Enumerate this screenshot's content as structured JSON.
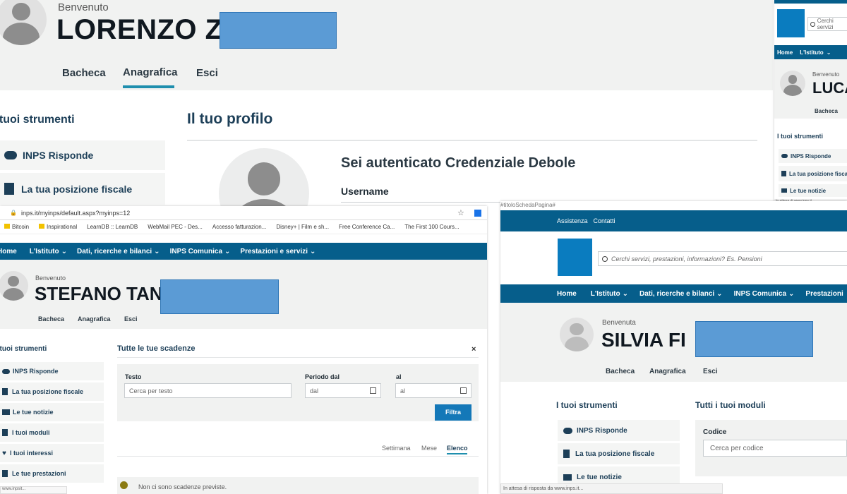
{
  "p1": {
    "welcome": "Benvenuto",
    "name": "LORENZO Z",
    "nav": [
      "Bacheca",
      "Anagrafica",
      "Esci"
    ],
    "tools_title": "I tuoi strumenti",
    "tools": [
      "INPS Risponde",
      "La tua posizione fiscale"
    ],
    "profile_title": "Il tuo profilo",
    "auth_text": "Sei autenticato Credenziale Debole",
    "username_label": "Username"
  },
  "p2": {
    "welcome": "Benvenuto",
    "name": "LUCA",
    "nav": [
      "Home",
      "L'Istituto"
    ],
    "tab": "Bacheca",
    "search_placeholder": "Cerchi servizi",
    "tools_title": "I tuoi strumenti",
    "tools": [
      "INPS Risponde",
      "La tua posizione fiscale",
      "Le tue notizie"
    ],
    "status": "In attesa di www.inps.it..."
  },
  "p3": {
    "url": "inps.it/myinps/default.aspx?myinps=12",
    "bookmarks": [
      "Bitcoin",
      "Inspirational",
      "LearnDB :: LearnDB",
      "WebMail PEC - Des...",
      "Accesso fatturazion...",
      "Disney+ | Film e sh...",
      "Free Conference Ca...",
      "The First 100 Cours..."
    ],
    "nav": [
      "Home",
      "L'Istituto",
      "Dati, ricerche e bilanci",
      "INPS Comunica",
      "Prestazioni e servizi"
    ],
    "welcome": "Benvenuto",
    "name": "STEFANO TAN",
    "tabs": [
      "Bacheca",
      "Anagrafica",
      "Esci"
    ],
    "tools_title": "I tuoi strumenti",
    "tools": [
      "INPS Risponde",
      "La tua posizione fiscale",
      "Le tue notizie",
      "I tuoi moduli",
      "I tuoi interessi",
      "Le tue prestazioni"
    ],
    "deadlines_title": "Tutte le tue scadenze",
    "close": "×",
    "testo_label": "Testo",
    "testo_placeholder": "Cerca per testo",
    "periodo_label": "Periodo dal",
    "dal_placeholder": "dal",
    "al_label": "al",
    "al_placeholder": "al",
    "filter_button": "Filtra",
    "view_tabs": [
      "Settimana",
      "Mese",
      "Elenco"
    ],
    "empty_message": "Non ci sono scadenze previste.",
    "status": "www.inpsit..."
  },
  "p4": {
    "page_tag": "#titoloSchedaPagina#",
    "top_links": [
      "Assistenza",
      "Contatti"
    ],
    "search_placeholder": "Cerchi servizi, prestazioni, informazioni? Es. Pensioni",
    "nav": [
      "Home",
      "L'Istituto",
      "Dati, ricerche e bilanci",
      "INPS Comunica",
      "Prestazioni"
    ],
    "welcome": "Benvenuta",
    "name": "SILVIA FI",
    "tabs": [
      "Bacheca",
      "Anagrafica",
      "Esci"
    ],
    "tools_title": "I tuoi strumenti",
    "tools": [
      "INPS Risponde",
      "La tua posizione fiscale",
      "Le tue notizie"
    ],
    "modules_title": "Tutti i tuoi moduli",
    "code_label": "Codice",
    "code_placeholder": "Cerca per codice",
    "status": "In attesa di risposta da www.inps.it..."
  },
  "colors": {
    "brand_blue": "#065e8b",
    "accent_teal": "#1f8fae",
    "redaction": "#5b9bd5"
  }
}
